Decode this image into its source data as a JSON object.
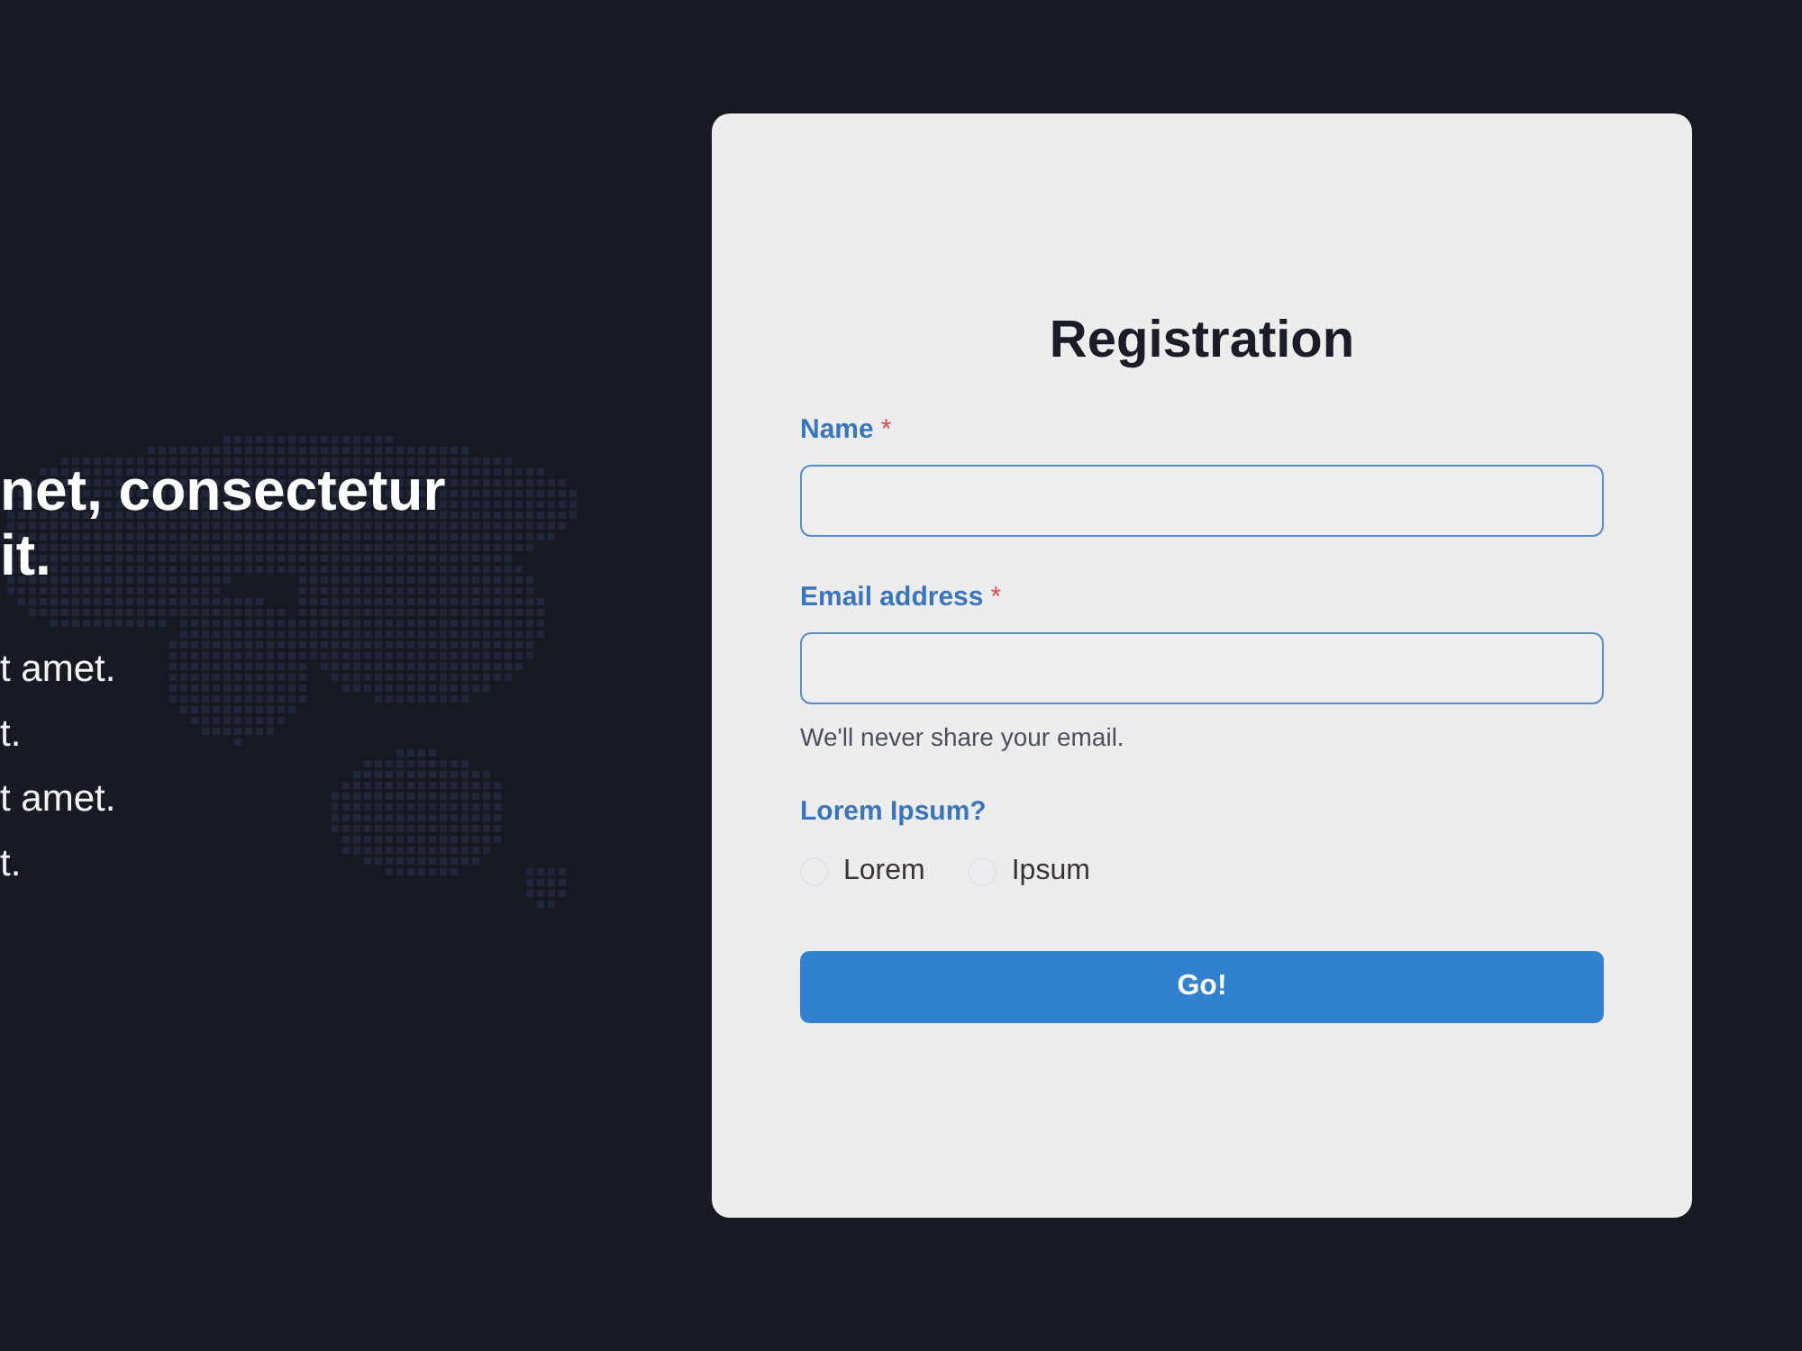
{
  "hero": {
    "heading_lines": [
      "net, consectetur",
      "it."
    ],
    "lines": [
      "t amet.",
      "t.",
      "t amet.",
      "t."
    ]
  },
  "form": {
    "title": "Registration",
    "fields": [
      {
        "label": "Name",
        "required_mark": "*"
      },
      {
        "label": "Email address",
        "required_mark": "*",
        "help": "We'll never share your email."
      }
    ],
    "choice": {
      "label": "Lorem Ipsum?",
      "options": [
        {
          "label": "Lorem",
          "selected": false
        },
        {
          "label": "Ipsum",
          "selected": false
        }
      ]
    },
    "submit": "Go!"
  }
}
